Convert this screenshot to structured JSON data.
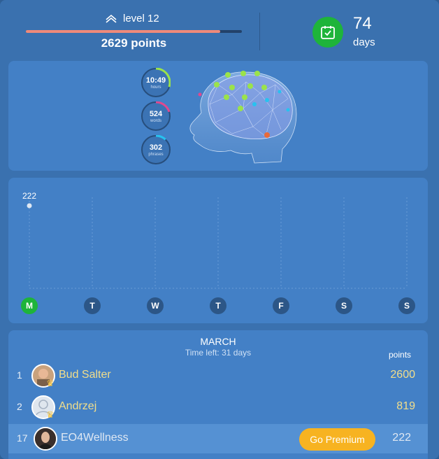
{
  "header": {
    "level_label": "level 12",
    "level_progress": 0.9,
    "points_label": "2629 points",
    "streak_value": "74",
    "streak_unit": "days"
  },
  "stats": [
    {
      "value": "10:49",
      "label": "hours",
      "color": "#9be34a",
      "progress": 0.3
    },
    {
      "value": "524",
      "label": "words",
      "color": "#e0488f",
      "progress": 0.2
    },
    {
      "value": "302",
      "label": "phrases",
      "color": "#27c2f0",
      "progress": 0.12
    }
  ],
  "chart_data": {
    "type": "scatter",
    "categories": [
      "M",
      "T",
      "W",
      "T",
      "F",
      "S",
      "S"
    ],
    "values": [
      222,
      null,
      null,
      null,
      null,
      null,
      null
    ],
    "data_labels": [
      "222",
      "",
      "",
      "",
      "",
      "",
      ""
    ],
    "active_day": 0,
    "grid": true
  },
  "leaderboard": {
    "month": "MARCH",
    "time_left": "Time left: 31 days",
    "points_header": "points",
    "rows": [
      {
        "rank": "1",
        "name": "Bud Salter",
        "score": "2600"
      },
      {
        "rank": "2",
        "name": "Andrzej",
        "score": "819"
      },
      {
        "rank": "17",
        "name": "EO4Wellness",
        "score": "222"
      }
    ],
    "premium_button": "Go Premium"
  },
  "colors": {
    "accent_green": "#1eb43a",
    "premium": "#f7b321",
    "progress": "#ef8a7a"
  }
}
